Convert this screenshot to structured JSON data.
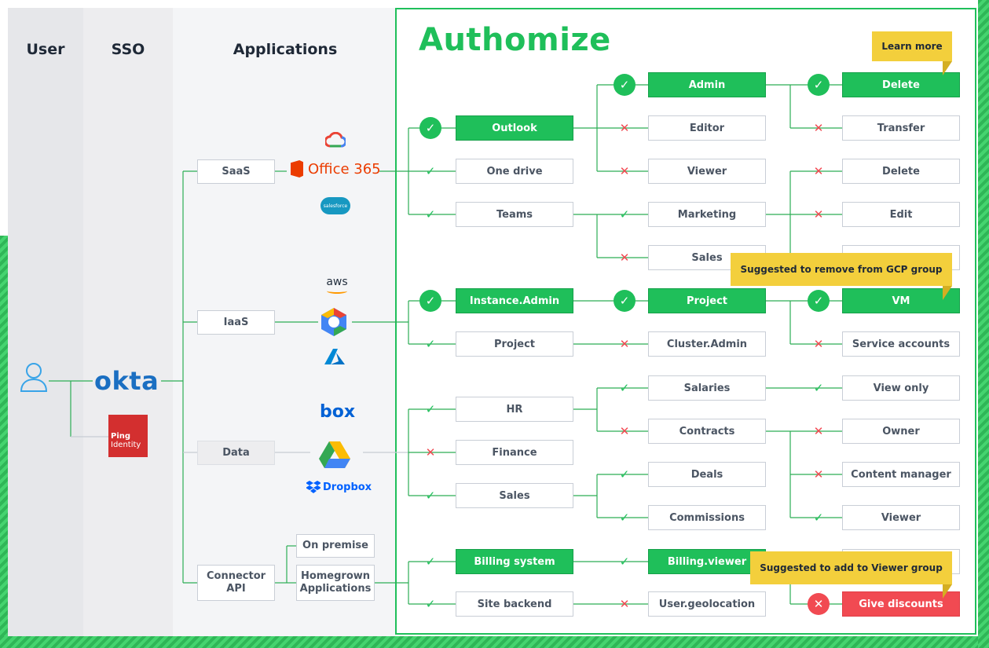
{
  "columns": {
    "user": "User",
    "sso": "SSO",
    "applications": "Applications"
  },
  "brand": "Authomize",
  "sso": {
    "okta": "okta",
    "ping_top": "Ping",
    "ping_bottom": "Identity"
  },
  "categories": {
    "saas": "SaaS",
    "iaas": "IaaS",
    "data": "Data",
    "connector": "Connector API"
  },
  "connector_types": {
    "on_premise": "On premise",
    "homegrown": "Homegrown Applications"
  },
  "logos": {
    "aws": "aws",
    "office365": "Office 365",
    "salesforce": "salesforce",
    "box": "box",
    "dropbox": "Dropbox"
  },
  "apps_col": [
    "Outlook",
    "One drive",
    "Teams",
    "Instance.Admin",
    "Project",
    "HR",
    "Finance",
    "Sales",
    "Billing system",
    "Site backend"
  ],
  "roles_col": [
    "Admin",
    "Editor",
    "Viewer",
    "Marketing",
    "Sales",
    "Project",
    "Cluster.Admin",
    "Salaries",
    "Contracts",
    "Deals",
    "Commissions",
    "Billing.viewer",
    "User.geolocation"
  ],
  "perms_col": [
    "Delete",
    "Transfer",
    "Delete",
    "Edit",
    "VM",
    "Service accounts",
    "View only",
    "Owner",
    "Content manager",
    "Viewer",
    "Give discounts"
  ],
  "callouts": {
    "learn_more": "Learn more",
    "gcp": "Suggested to remove from GCP group",
    "viewer": "Suggested to add to Viewer group"
  },
  "colors": {
    "green": "#1fbf5a",
    "red": "#f14a52",
    "yellow": "#f3cf3c",
    "stripe": "#2fb657"
  }
}
